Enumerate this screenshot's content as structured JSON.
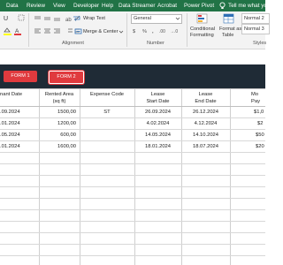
{
  "ribbon_tabs": [
    "Data",
    "Review",
    "View",
    "Developer",
    "Help",
    "Data Streamer",
    "Acrobat",
    "Power Pivot"
  ],
  "tell_me": "Tell me what you",
  "ribbon": {
    "wrap_text": "Wrap Text",
    "merge_center": "Merge & Center",
    "number_format": "General",
    "alignment_group": "Alignment",
    "number_group": "Number",
    "conditional_formatting": [
      "Conditional",
      "Formatting"
    ],
    "format_as_table": [
      "Format as",
      "Table"
    ],
    "styles_normal": [
      "Normal 2",
      "Normal 3"
    ],
    "styles_group": "Styles",
    "currency_symbol": "$",
    "percent_symbol": "%",
    "comma_symbol": ",",
    "decimals": [
      ".00",
      "→.0"
    ]
  },
  "buttons": {
    "form1": "FORM 1",
    "form2": "FORM 2"
  },
  "table": {
    "headers": [
      [
        "nant Date",
        ""
      ],
      [
        "Rented Area",
        "(sq ft)"
      ],
      [
        "Expense Code",
        ""
      ],
      [
        "Lease",
        "Start Date"
      ],
      [
        "Lease",
        "End Date"
      ],
      [
        "Mo",
        "Pay"
      ]
    ],
    "rows": [
      [
        ".09.2024",
        "1500,00",
        "ST",
        "26.09.2024",
        "26.12.2024",
        "$1,0"
      ],
      [
        ".01.2024",
        "1200,00",
        "",
        "4.02.2024",
        "4.12.2024",
        "$2"
      ],
      [
        ".05.2024",
        "600,00",
        "",
        "14.05.2024",
        "14.10.2024",
        "$50"
      ],
      [
        ".01.2024",
        "1600,00",
        "",
        "18.01.2024",
        "18.07.2024",
        "$20"
      ]
    ]
  }
}
